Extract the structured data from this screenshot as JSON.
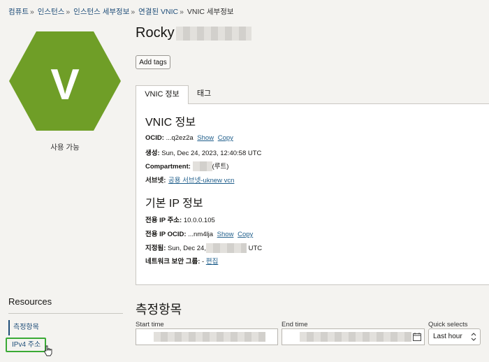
{
  "breadcrumb": {
    "items": [
      "컴퓨트",
      "인스턴스",
      "인스턴스 세부정보",
      "연결된 VNIC"
    ],
    "separator": "»",
    "current": "VNIC 세부정보"
  },
  "status": {
    "letter": "V",
    "label": "사용 가능",
    "color": "#6f9e27"
  },
  "header": {
    "title": "Rocky",
    "add_tags_label": "Add tags"
  },
  "tabs": [
    "VNIC 정보",
    "태그"
  ],
  "vnic_info": {
    "heading": "VNIC 정보",
    "ocid_label": "OCID:",
    "ocid_value": "...q2ez2a",
    "show_label": "Show",
    "copy_label": "Copy",
    "created_label": "생성:",
    "created_value": "Sun, Dec 24, 2023, 12:40:58 UTC",
    "compartment_label": "Compartment:",
    "compartment_suffix": "(루트)",
    "subnet_label": "서브넷:",
    "subnet_value": "공용 서브넷-uknew vcn"
  },
  "ip_info": {
    "heading": "기본 IP 정보",
    "private_ip_label": "전용 IP 주소:",
    "private_ip_value": "10.0.0.105",
    "private_ocid_label": "전용 IP OCID:",
    "private_ocid_value": "...nm4lja",
    "show_label": "Show",
    "copy_label": "Copy",
    "assigned_label": "지정됨:",
    "assigned_prefix": "Sun, Dec 24,",
    "assigned_suffix": "UTC",
    "nsg_label": "네트워크 보안 그룹:",
    "nsg_value": "-",
    "edit_label": "편집"
  },
  "resources": {
    "title": "Resources",
    "items": [
      "측정항목",
      "IPv4 주소"
    ]
  },
  "metrics": {
    "title": "측정항목",
    "start_label": "Start time",
    "end_label": "End time",
    "quick_label": "Quick selects",
    "quick_value": "Last hour"
  }
}
